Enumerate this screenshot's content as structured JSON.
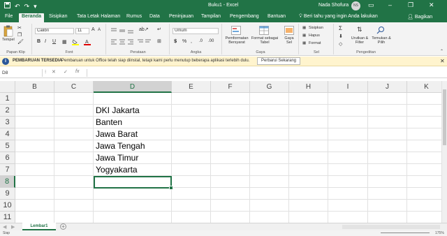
{
  "titlebar": {
    "title": "Buku1  -  Excel",
    "user": "Nada Shofura",
    "avatar_initials": "NS",
    "icons": [
      "save-icon",
      "undo-icon",
      "redo-icon",
      "customize-qat-icon",
      "ribbon-display-icon",
      "minimize-icon",
      "restore-icon",
      "close-icon"
    ]
  },
  "tabs": {
    "items": [
      "File",
      "Beranda",
      "Sisipkan",
      "Tata Letak Halaman",
      "Rumus",
      "Data",
      "Peninjauan",
      "Tampilan",
      "Pengembang",
      "Bantuan"
    ],
    "active": "Beranda",
    "tell_me": "Beri tahu yang ingin Anda lakukan",
    "share": "Bagikan"
  },
  "ribbon": {
    "clipboard": {
      "label": "Papan Klip",
      "paste": "Tempel"
    },
    "font": {
      "label": "Font",
      "name": "Calibri",
      "size": "11",
      "bold": "B",
      "italic": "I",
      "underline": "U"
    },
    "alignment": {
      "label": "Perataan"
    },
    "number": {
      "label": "Angka",
      "format": "Umum"
    },
    "styles": {
      "label": "Gaya",
      "conditional": "Pemformatan Bersyarat",
      "table": "Format sebagai Tabel",
      "cell_styles": "Gaya Sel"
    },
    "cells": {
      "label": "Sel",
      "insert": "Sisipkan",
      "delete": "Hapus",
      "format": "Format"
    },
    "editing": {
      "label": "Pengeditan",
      "sort": "Urutkan & Filter",
      "find": "Temukan & Pilih"
    }
  },
  "update_bar": {
    "title": "PEMBARUAN TERSEDIA",
    "message": "Pembaruan untuk Office telah siap diinstal, tetapi kami perlu menutup beberapa aplikasi terlebih dulu.",
    "button": "Perbarui Sekarang"
  },
  "formula_bar": {
    "name_box": "D8",
    "cancel": "✕",
    "enter": "✓",
    "fx": "fx",
    "value": ""
  },
  "sheet": {
    "columns": [
      "B",
      "C",
      "D",
      "E",
      "F",
      "G",
      "H",
      "I",
      "J",
      "K"
    ],
    "selected_column": "D",
    "rows": [
      "1",
      "2",
      "3",
      "4",
      "5",
      "6",
      "7",
      "8",
      "9",
      "10",
      "11"
    ],
    "selected_row": "8",
    "cells_D": [
      "",
      "DKI Jakarta",
      "Banten",
      "Jawa Barat",
      "Jawa Tengah",
      "Jawa Timur",
      "Yogyakarta",
      "",
      "",
      "",
      ""
    ]
  },
  "sheet_tabs": {
    "active": "Lembar1",
    "add": "+"
  },
  "status_bar": {
    "ready": "Siap",
    "zoom": "175%"
  },
  "colors": {
    "accent": "#217346",
    "ribbon_bg": "#f3f3f3",
    "update_bar": "#fff4ce"
  }
}
